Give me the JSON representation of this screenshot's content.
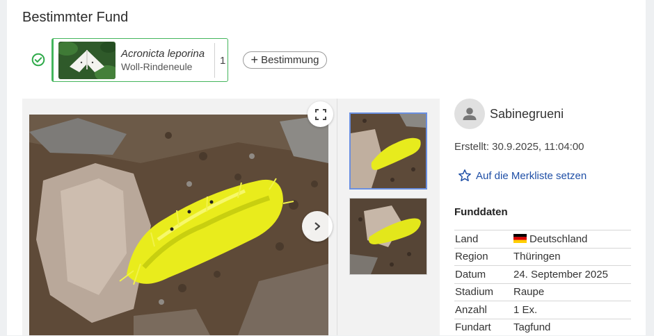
{
  "page": {
    "title": "Bestimmter Fund"
  },
  "determination": {
    "scientific_name": "Acronicta leporina",
    "common_name": "Woll-Rindeneule",
    "count": "1",
    "add_button_label": "Bestimmung"
  },
  "user": {
    "name": "Sabinegrueni"
  },
  "created": "Erstellt: 30.9.2025, 11:04:00",
  "watchlist_label": "Auf die Merkliste setzen",
  "facts": {
    "title": "Funddaten",
    "rows": [
      {
        "label": "Land",
        "value": "Deutschland"
      },
      {
        "label": "Region",
        "value": "Thüringen"
      },
      {
        "label": "Datum",
        "value": "24. September 2025"
      },
      {
        "label": "Stadium",
        "value": "Raupe"
      },
      {
        "label": "Anzahl",
        "value": "1 Ex."
      },
      {
        "label": "Fundart",
        "value": "Tagfund"
      }
    ]
  },
  "colors": {
    "accent_green": "#43b55b",
    "link_blue": "#1f4fa6",
    "selected_border": "#6a8fe0"
  }
}
